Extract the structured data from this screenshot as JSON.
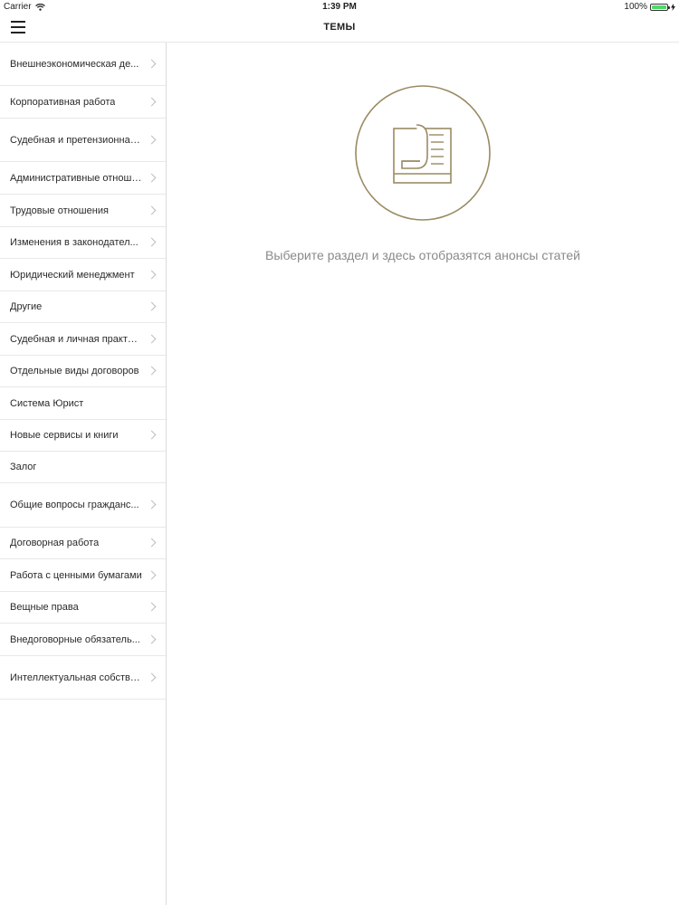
{
  "status_bar": {
    "carrier": "Carrier",
    "time": "1:39 PM",
    "battery": "100%"
  },
  "nav": {
    "title": "ТЕМЫ"
  },
  "sidebar": {
    "items": [
      {
        "label": "Внешнеэкономическая де...",
        "has_chevron": true
      },
      {
        "label": "Корпоративная работа",
        "has_chevron": true
      },
      {
        "label": "Судебная и претензионная...",
        "has_chevron": true
      },
      {
        "label": "Административные отноше...",
        "has_chevron": true
      },
      {
        "label": "Трудовые отношения",
        "has_chevron": true
      },
      {
        "label": "Изменения в законодател...",
        "has_chevron": true
      },
      {
        "label": "Юридический менеджмент",
        "has_chevron": true
      },
      {
        "label": "Другие",
        "has_chevron": true
      },
      {
        "label": "Судебная и личная практика",
        "has_chevron": true
      },
      {
        "label": "Отдельные виды договоров",
        "has_chevron": true
      },
      {
        "label": "Система Юрист",
        "has_chevron": false
      },
      {
        "label": "Новые сервисы и книги",
        "has_chevron": true
      },
      {
        "label": "Залог",
        "has_chevron": false
      },
      {
        "label": "Общие вопросы граждaнс...",
        "has_chevron": true
      },
      {
        "label": "Договорная работа",
        "has_chevron": true
      },
      {
        "label": "Работа с ценными бумагами",
        "has_chevron": true
      },
      {
        "label": "Вещные права",
        "has_chevron": true
      },
      {
        "label": "Внедоговорные обязатель...",
        "has_chevron": true
      },
      {
        "label": "Интеллектуальная собстве...",
        "has_chevron": true
      }
    ]
  },
  "main": {
    "empty_message": "Выберите раздел и здесь отобразятся анонсы статей",
    "illustration_icon": "document-icon"
  },
  "colors": {
    "accent": "#9a8a62",
    "battery": "#4cd964"
  }
}
